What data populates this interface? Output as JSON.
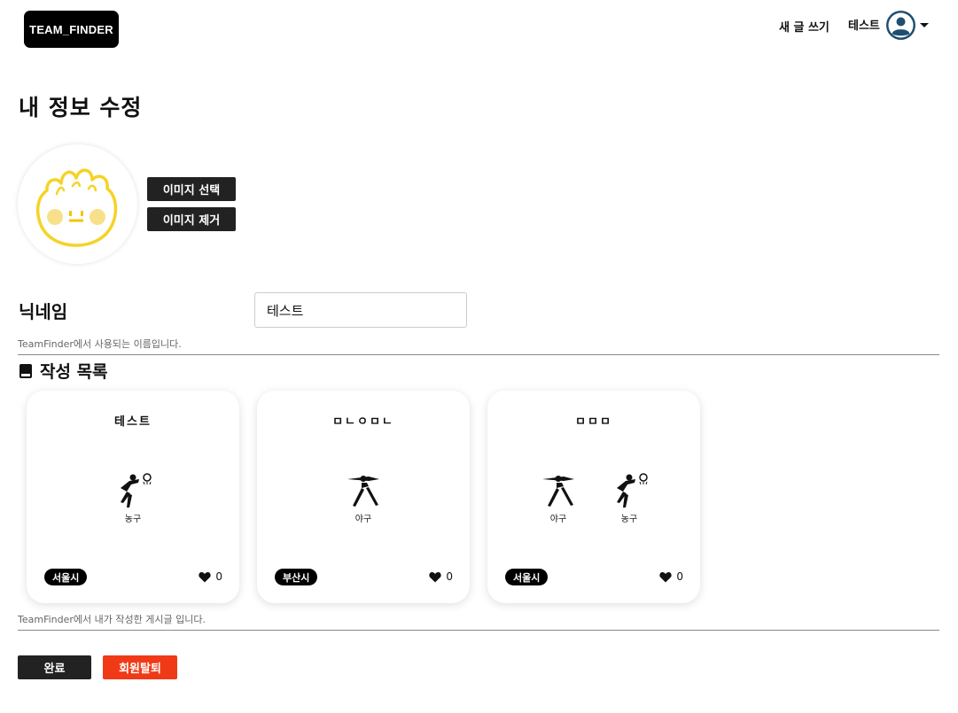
{
  "header": {
    "logo": "TEAM_FINDER",
    "write_label": "새 글 쓰기",
    "user_name": "테스트"
  },
  "page": {
    "title": "내 정보 수정"
  },
  "profile": {
    "select_image_label": "이미지 선택",
    "remove_image_label": "이미지 제거"
  },
  "nickname": {
    "label": "닉네임",
    "value": "테스트",
    "help": "TeamFinder에서 사용되는 이름입니다."
  },
  "posts": {
    "section_title": "작성 목록",
    "help": "TeamFinder에서 내가 작성한 게시글 입니다.",
    "items": [
      {
        "title": "테스트",
        "sports": [
          "농구"
        ],
        "region": "서울시",
        "likes": "0"
      },
      {
        "title": "ㅁㄴㅇㅁㄴ",
        "sports": [
          "야구"
        ],
        "region": "부산시",
        "likes": "0"
      },
      {
        "title": "ㅁㅁㅁ",
        "sports": [
          "야구",
          "농구"
        ],
        "region": "서울시",
        "likes": "0"
      }
    ]
  },
  "actions": {
    "done_label": "완료",
    "withdraw_label": "회원탈퇴"
  },
  "colors": {
    "primary_dark": "#222222",
    "danger": "#f03a17",
    "mascot_yellow": "#f5d327"
  }
}
